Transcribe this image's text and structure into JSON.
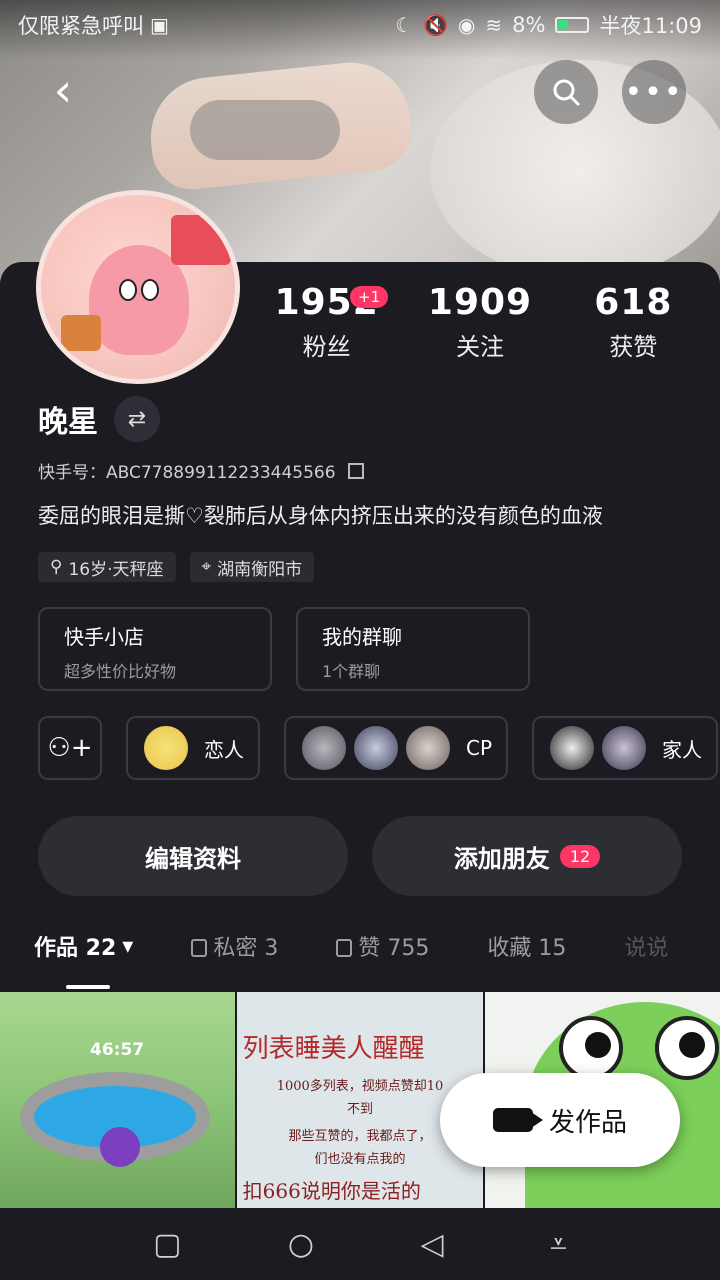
{
  "status_bar": {
    "carrier": "仅限紧急呼叫",
    "battery": "8%",
    "time": "半夜11:09"
  },
  "profile": {
    "name": "晚星",
    "kuaishou_id": "快手号：ABC778899112233445566",
    "bio": "委屈的眼泪是撕♡裂肺后从身体内挤压出来的没有颜色的血液",
    "tags": [
      "16岁·天秤座",
      "湖南衡阳市"
    ],
    "stats": [
      {
        "num": "1952",
        "label": "粉丝"
      },
      {
        "num": "1909",
        "label": "关注"
      },
      {
        "num": "618",
        "label": "获赞"
      }
    ],
    "fans_badge": "+1"
  },
  "cards": [
    {
      "title": "快手小店",
      "sub": "超多性价比好物"
    },
    {
      "title": "我的群聊",
      "sub": "1个群聊"
    }
  ],
  "relations": [
    {
      "label": "恋人"
    },
    {
      "label": "CP"
    },
    {
      "label": "家人"
    }
  ],
  "actions": {
    "edit": "编辑资料",
    "add_friend": "添加朋友",
    "add_badge": "12"
  },
  "tabs": [
    {
      "label": "作品 22"
    },
    {
      "label": "私密 3"
    },
    {
      "label": "赞 755"
    },
    {
      "label": "收藏 15"
    },
    {
      "label": "说说"
    }
  ],
  "grid": {
    "cell1_timer": "46:57",
    "cell2_title": "列表睡美人醒醒",
    "cell2_line1": "1000多列表，视频点赞却10",
    "cell2_line2": "不到",
    "cell2_line3": "那些互赞的，我都点了，",
    "cell2_line4": "们也没有点我的",
    "cell2_bottom": "扣666说明你是活的"
  },
  "fab": {
    "label": "发作品"
  },
  "colors": {
    "accent": "#fe3666",
    "panel": "#1b1b21"
  }
}
